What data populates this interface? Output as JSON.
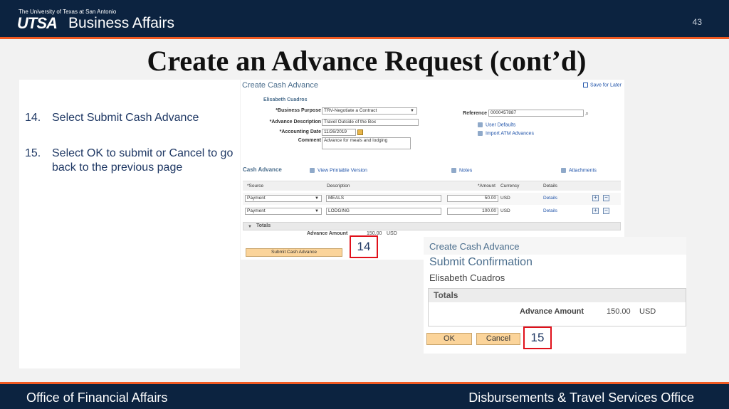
{
  "header": {
    "university_line": "The University of Texas at San Antonio",
    "logo_utsa": "UTSA",
    "logo_unit": "Business Affairs",
    "slide_number": "43"
  },
  "title": "Create an Advance Request (cont’d)",
  "steps": [
    {
      "num": "14.",
      "text": "Select Submit Cash Advance"
    },
    {
      "num": "15.",
      "text": "Select OK to submit or Cancel to go back to the previous page"
    }
  ],
  "screen1": {
    "page_title": "Create Cash Advance",
    "save_for_later": "Save for Later",
    "employee_name": "Elisabeth Cuadros",
    "fields": {
      "business_purpose_label": "*Business Purpose",
      "business_purpose_value": "TRV-Negotiate a Contract",
      "advance_description_label": "*Advance Description",
      "advance_description_value": "Travel Outside of the Box",
      "accounting_date_label": "*Accounting Date",
      "accounting_date_value": "11/26/2019",
      "comment_label": "Comment",
      "comment_value": "Advance for meals and lodging",
      "reference_label": "Reference",
      "reference_value": "0000457887"
    },
    "links": {
      "user_defaults": "User Defaults",
      "import_atm": "Import ATM Advances",
      "view_printable": "View Printable Version",
      "notes": "Notes",
      "attachments": "Attachments"
    },
    "section_title": "Cash Advance",
    "grid_headers": {
      "source": "*Source",
      "description": "Description",
      "amount": "*Amount",
      "currency": "Currency",
      "details": "Details"
    },
    "rows": [
      {
        "source": "Payment",
        "description": "MEALS",
        "amount": "50.00",
        "currency": "USD",
        "details": "Details"
      },
      {
        "source": "Payment",
        "description": "LODGING",
        "amount": "100.00",
        "currency": "USD",
        "details": "Details"
      }
    ],
    "totals_label": "Totals",
    "advance_amount_label": "Advance Amount",
    "advance_amount_value": "150.00",
    "advance_amount_currency": "USD",
    "submit_button": "Submit Cash Advance"
  },
  "callouts": {
    "c14": "14",
    "c15": "15"
  },
  "screen2": {
    "page_title": "Create Cash Advance",
    "subtitle": "Submit Confirmation",
    "employee_name": "Elisabeth Cuadros",
    "totals_label": "Totals",
    "advance_amount_label": "Advance Amount",
    "advance_amount_value": "150.00",
    "advance_amount_currency": "USD",
    "ok_button": "OK",
    "cancel_button": "Cancel"
  },
  "footer": {
    "left": "Office of Financial Affairs",
    "right": "Disbursements & Travel Services Office"
  },
  "colors": {
    "navy": "#0c2340",
    "orange": "#f15a22",
    "callout_red": "#e0101a",
    "button_orange": "#fbd49a"
  }
}
